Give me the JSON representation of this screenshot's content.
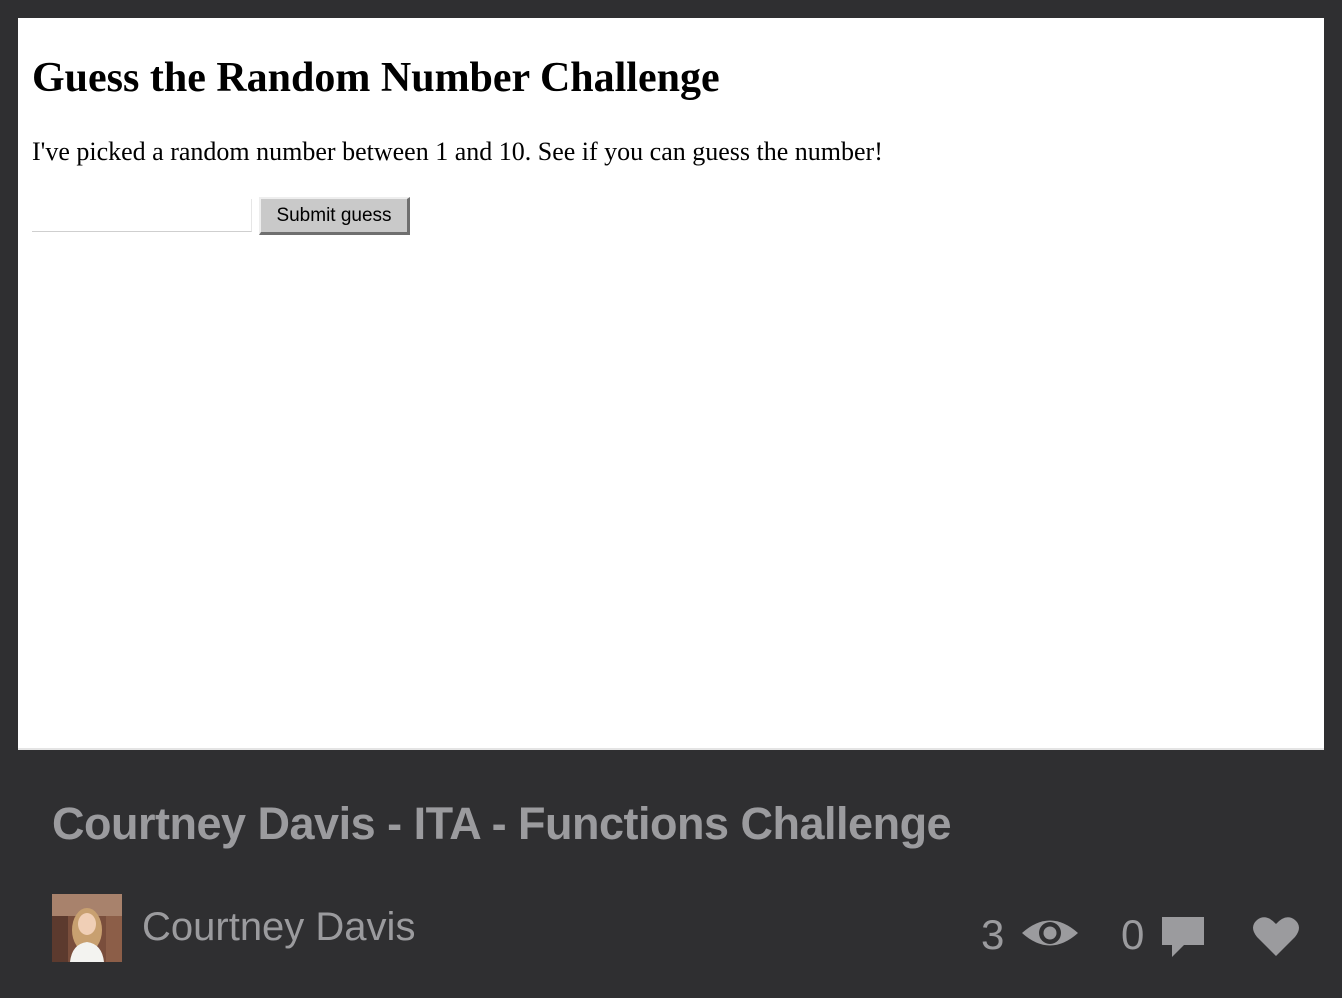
{
  "preview": {
    "heading": "Guess the Random Number Challenge",
    "description": "I've picked a random number between 1 and 10. See if you can guess the number!",
    "guess_input": {
      "value": "",
      "placeholder": ""
    },
    "submit_label": "Submit guess"
  },
  "project": {
    "title": "Courtney Davis - ITA - Functions Challenge",
    "author": {
      "name": "Courtney Davis",
      "avatar_icon": "user-avatar-photo"
    },
    "stats": {
      "views": "3",
      "views_icon": "eye-icon",
      "comments": "0",
      "comments_icon": "speech-bubble-icon",
      "like_icon": "heart-icon"
    }
  },
  "colors": {
    "background": "#2f2f31",
    "muted_text": "#9b9b9e",
    "preview_bg": "#ffffff",
    "button_bg": "#c9c9c9"
  }
}
